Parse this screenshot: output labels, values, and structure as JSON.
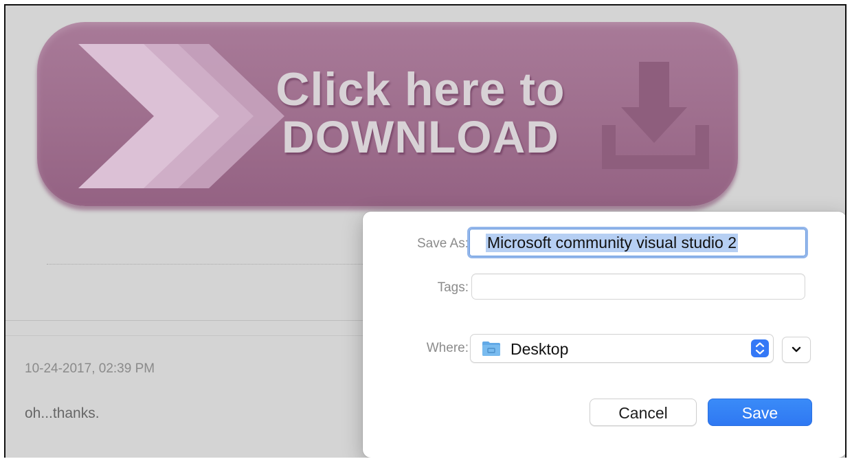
{
  "banner": {
    "line1": "Click here to",
    "line2": "DOWNLOAD",
    "colors": {
      "background": "#a2728f",
      "text": "#d8d2d6",
      "arrows": "#d4b6cc"
    },
    "icons": [
      "chevrons-right-icon",
      "download-tray-icon"
    ]
  },
  "post": {
    "date": "10-24-2017, 02:39 PM",
    "text": "oh...thanks."
  },
  "dialog": {
    "save_as_label": "Save As:",
    "save_as_value": "Microsoft community visual studio 2",
    "tags_label": "Tags:",
    "tags_value": "",
    "where_label": "Where:",
    "where_value": "Desktop",
    "where_icon": "folder-icon",
    "cancel_label": "Cancel",
    "save_label": "Save",
    "accent_color": "#3478f6"
  }
}
